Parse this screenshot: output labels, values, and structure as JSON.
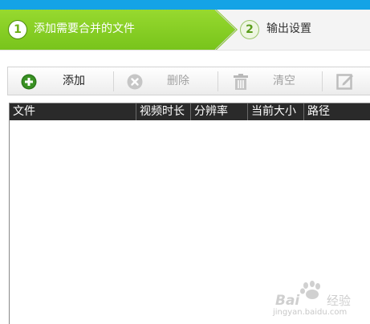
{
  "wizard": {
    "steps": [
      {
        "number": "1",
        "label": "添加需要合并的文件",
        "active": true
      },
      {
        "number": "2",
        "label": "输出设置",
        "active": false
      }
    ]
  },
  "toolbar": {
    "add": {
      "label": "添加",
      "icon": "plus-circle-icon",
      "enabled": true
    },
    "delete": {
      "label": "删除",
      "icon": "x-circle-icon",
      "enabled": false
    },
    "clear": {
      "label": "清空",
      "icon": "trash-icon",
      "enabled": false
    },
    "edit": {
      "label": "",
      "icon": "edit-icon",
      "enabled": false
    }
  },
  "file_list": {
    "columns": [
      "文件",
      "视频时长",
      "分辨率",
      "当前大小",
      "路径"
    ],
    "rows": []
  },
  "watermark": {
    "logo_text": "Baidu经验",
    "url": "jingyan.baidu.com"
  },
  "colors": {
    "top_strip": "#14a3e6",
    "active_step": "#86cc22",
    "header_bg": "#2a2a2a",
    "add_icon": "#2d7a1c"
  }
}
